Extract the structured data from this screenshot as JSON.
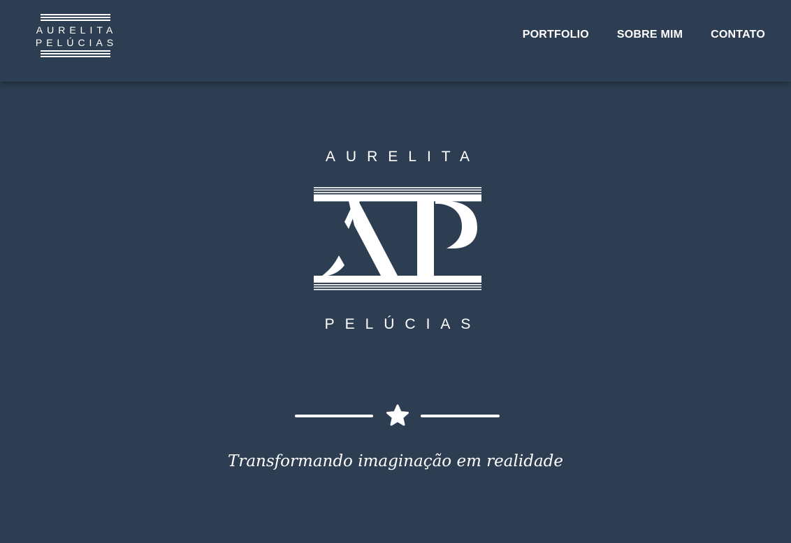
{
  "brand": {
    "line1": "AURELITA",
    "line2": "PELÚCIAS"
  },
  "nav": {
    "items": [
      {
        "label": "PORTFOLIO"
      },
      {
        "label": "SOBRE MIM"
      },
      {
        "label": "CONTATO"
      }
    ]
  },
  "hero": {
    "top_word": "AURELITA",
    "bottom_word": "PELÚCIAS",
    "monogram": "AP",
    "divider_icon": "star-icon",
    "tagline": "Transformando imaginação em realidade"
  },
  "colors": {
    "background": "#2e3e52",
    "foreground": "#ffffff"
  }
}
